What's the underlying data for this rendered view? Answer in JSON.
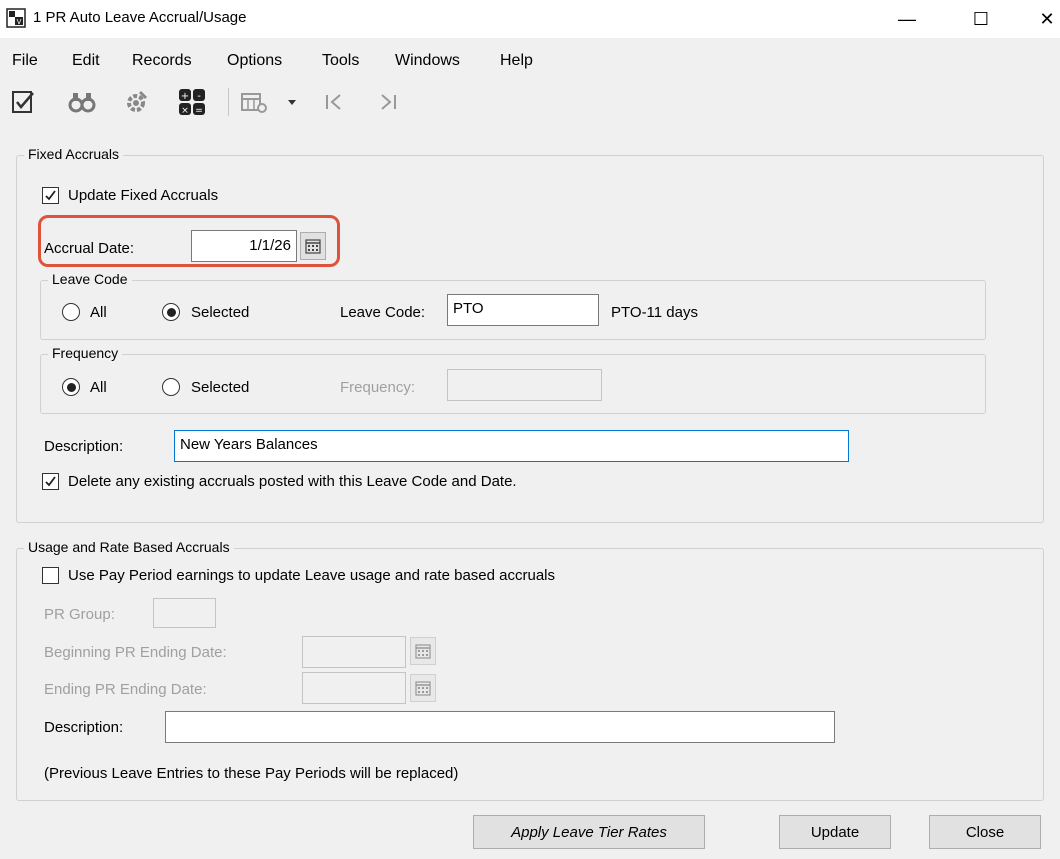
{
  "window": {
    "title": "1 PR Auto Leave Accrual/Usage",
    "minimize": "—",
    "maximize": "☐",
    "close": "✕"
  },
  "menu": [
    "File",
    "Edit",
    "Records",
    "Options",
    "Tools",
    "Windows",
    "Help"
  ],
  "toolbar": {
    "icons": [
      "checklist-icon",
      "binoculars-icon",
      "settings-icon",
      "calculator-icon",
      "grid-settings-icon",
      "dropdown-arrow-icon",
      "first-record-icon",
      "last-record-icon"
    ]
  },
  "fixed": {
    "group_label": "Fixed Accruals",
    "update_label": "Update Fixed Accruals",
    "update_checked": true,
    "accrual_date_label": "Accrual Date:",
    "accrual_date_value": "1/1/26",
    "leave_code_group": "Leave Code",
    "leave_all": "All",
    "leave_selected": "Selected",
    "leave_selected_value": "Selected",
    "leave_code_label": "Leave Code:",
    "leave_code_value": "PTO",
    "leave_code_desc": "PTO-11 days",
    "frequency_group": "Frequency",
    "freq_all": "All",
    "freq_selected": "Selected",
    "freq_selected_value": "All",
    "frequency_label": "Frequency:",
    "frequency_value": "",
    "description_label": "Description:",
    "description_value": "New Years Balances",
    "delete_label": "Delete any existing accruals posted with this Leave Code and Date.",
    "delete_checked": true
  },
  "usage": {
    "group_label": "Usage and Rate Based Accruals",
    "use_pay_label": "Use Pay Period earnings to update Leave usage and rate based accruals",
    "use_pay_checked": false,
    "pr_group_label": "PR Group:",
    "pr_group_value": "",
    "begin_label": "Beginning PR Ending Date:",
    "begin_value": "",
    "end_label": "Ending PR Ending Date:",
    "end_value": "",
    "description_label": "Description:",
    "description_value": "",
    "note": "(Previous Leave Entries to these Pay Periods will be replaced)"
  },
  "buttons": {
    "apply": "Apply Leave Tier Rates",
    "update": "Update",
    "close": "Close"
  },
  "colors": {
    "highlight": "#e0533b",
    "focus_border": "#0078d7"
  }
}
